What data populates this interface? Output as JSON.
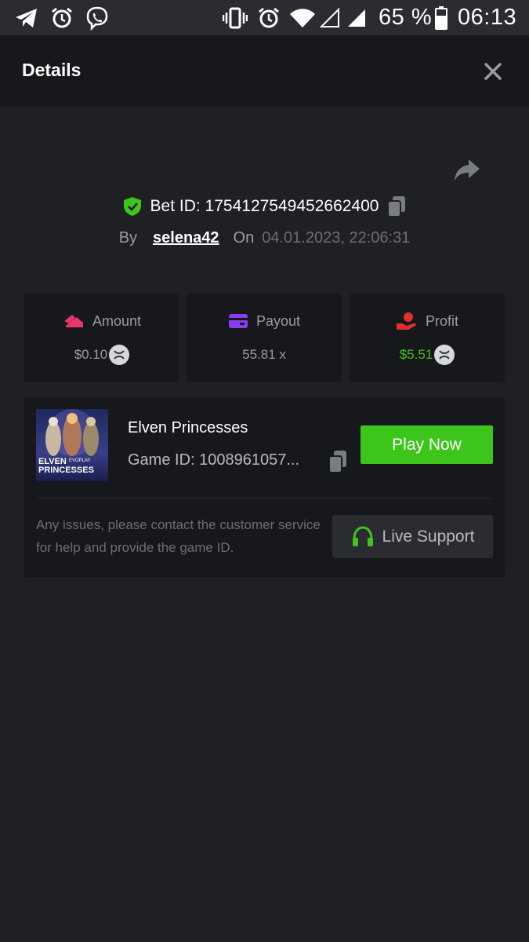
{
  "status_bar": {
    "battery_percent": "65 %",
    "time": "06:13",
    "left_icons": [
      "telegram-icon",
      "alarm-icon",
      "viber-icon"
    ],
    "right_icons": [
      "vibrate-icon",
      "alarm-icon",
      "wifi-icon",
      "signal-empty-icon",
      "signal-icon",
      "battery-icon"
    ]
  },
  "header": {
    "title": "Details"
  },
  "bet": {
    "id_label": "Bet ID: 1754127549452662400",
    "by_label": "By",
    "username": "selena42",
    "on_label": "On",
    "datetime": "04.01.2023, 22:06:31"
  },
  "stats": {
    "amount": {
      "label": "Amount",
      "value": "$0.10"
    },
    "payout": {
      "label": "Payout",
      "value": "55.81 x"
    },
    "profit": {
      "label": "Profit",
      "value": "$5.51"
    }
  },
  "game": {
    "name": "Elven Princesses",
    "id_label": "Game ID: 1008961057...",
    "thumb_title": "ELVEN PRINCESSES",
    "thumb_brand": "EVOPLAY",
    "play_label": "Play Now"
  },
  "support": {
    "help_text": "Any issues, please contact the customer service for help and provide the game ID.",
    "button_label": "Live Support"
  },
  "colors": {
    "background": "#1f2024",
    "panel": "#17181b",
    "accent_green": "#3cc51a",
    "amount_icon": "#e8356a",
    "payout_icon": "#8a3cf0",
    "profit_icon": "#e0302b"
  }
}
